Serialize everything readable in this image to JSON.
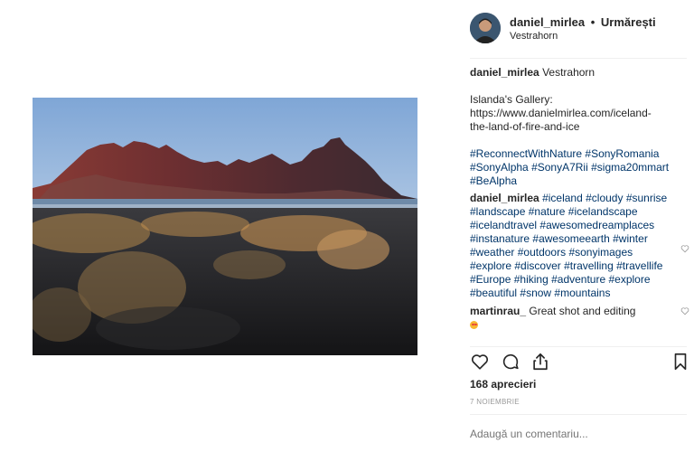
{
  "post": {
    "image_alt": "Vestrahorn mountains with black sand dunes and golden grass",
    "username": "daniel_mirlea",
    "separator": "•",
    "follow_label": "Urmărești",
    "location": "Vestrahorn"
  },
  "caption": {
    "username": "daniel_mirlea",
    "title": "Vestrahorn",
    "gallery_label": "Islanda's Gallery:",
    "gallery_link_line1": "https://www.danielmirlea.com/iceland-",
    "gallery_link_line2": "the-land-of-fire-and-ice",
    "hashtags": [
      "#ReconnectWithNature",
      "#SonyRomania",
      "#SonyAlpha",
      "#SonyA7Rii",
      "#sigma20mmart",
      "#BeAlpha"
    ]
  },
  "comments": [
    {
      "username": "daniel_mirlea",
      "hashtags": [
        "#iceland",
        "#cloudy",
        "#sunrise",
        "#landscape",
        "#nature",
        "#icelandscape",
        "#icelandtravel",
        "#awesomedreamplaces",
        "#instanature",
        "#awesomeearth",
        "#winter",
        "#weather",
        "#outdoors",
        "#sonyimages",
        "#explore",
        "#discover",
        "#travelling",
        "#travellife",
        "#Europe",
        "#hiking",
        "#adventure",
        "#explore",
        "#beautiful",
        "#snow",
        "#mountains"
      ]
    },
    {
      "username": "martinrau_",
      "text": "Great shot and editing"
    }
  ],
  "actions": {
    "like_icon": "heart-icon",
    "comment_icon": "comment-icon",
    "share_icon": "share-icon",
    "save_icon": "bookmark-icon"
  },
  "likes_text": "168 aprecieri",
  "date_text": "7 NOIEMBRIE",
  "add_comment_placeholder": "Adaugă un comentariu...",
  "colors": {
    "hashtag": "#003569",
    "text": "#262626",
    "muted": "#999999",
    "divider": "#efefef"
  }
}
